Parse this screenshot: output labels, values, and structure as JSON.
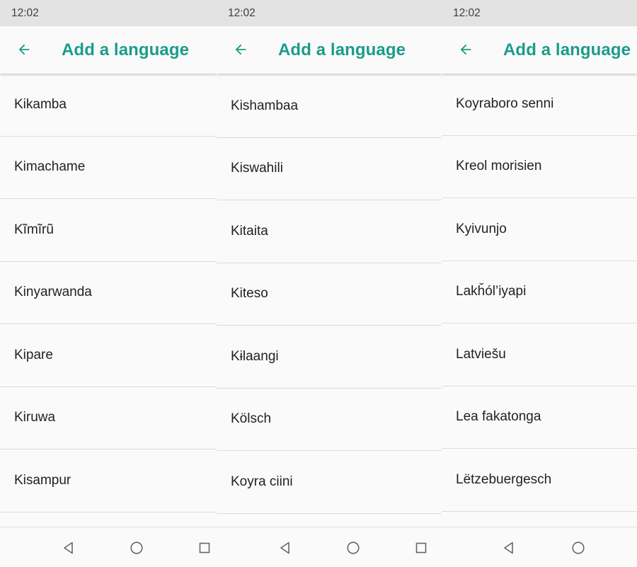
{
  "colors": {
    "accent": "#1b9c8a",
    "statusbar": "#e3e3e3",
    "background": "#fafafa"
  },
  "screens": [
    {
      "status_time": "12:02",
      "back_icon": "arrow-left-icon",
      "title": "Add a language",
      "languages": [
        "Kikamba",
        "Kimachame",
        "Kĩmĩrũ",
        "Kinyarwanda",
        "Kipare",
        "Kiruwa",
        "Kisampur"
      ],
      "nav": [
        "nav-back-icon",
        "nav-home-icon",
        "nav-recents-icon"
      ]
    },
    {
      "status_time": "12:02",
      "back_icon": "arrow-left-icon",
      "title": "Add a language",
      "languages": [
        "Kishambaa",
        "Kiswahili",
        "Kitaita",
        "Kiteso",
        "Kɨlaangi",
        "Kölsch",
        "Koyra ciini"
      ],
      "nav": [
        "nav-back-icon",
        "nav-home-icon",
        "nav-recents-icon"
      ]
    },
    {
      "status_time": "12:02",
      "back_icon": "arrow-left-icon",
      "title": "Add a language",
      "languages": [
        "Koyraboro senni",
        "Kreol morisien",
        "Kyivunjo",
        "Lakȟól’iyapi",
        "Latviešu",
        "Lea fakatonga",
        "Lëtzebuergesch"
      ],
      "nav": [
        "nav-back-icon",
        "nav-home-icon"
      ]
    }
  ]
}
